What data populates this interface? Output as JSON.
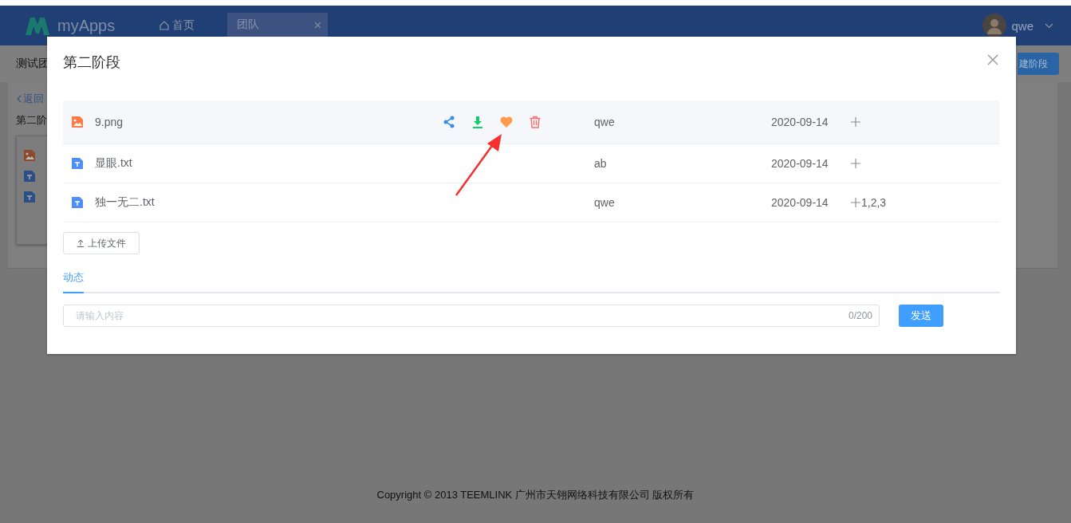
{
  "header": {
    "logo": "myApps",
    "home_link": "首页",
    "tabs": [
      {
        "label": "团队",
        "selected": true
      }
    ],
    "user": "qwe"
  },
  "subheader": {
    "title": "测试团",
    "button": "建阶段"
  },
  "background_panel": {
    "back_link": "返回",
    "stage_title": "第二阶",
    "files": [
      {
        "kind": "image"
      },
      {
        "kind": "text"
      },
      {
        "kind": "text"
      }
    ]
  },
  "dialog": {
    "title": "第二阶段",
    "files": [
      {
        "name": "9.png",
        "kind": "image",
        "hovered": true,
        "creator": "qwe",
        "date": "2020-09-14"
      },
      {
        "name": "显眼.txt",
        "kind": "text",
        "hovered": false,
        "creator": "ab",
        "date": "2020-09-14"
      },
      {
        "name": "独一无二.txt",
        "kind": "text",
        "hovered": false,
        "creator": "qwe",
        "date": "2020-09-14",
        "tags": "1,2,3"
      }
    ],
    "upload_button": "上传文件",
    "tabs": [
      {
        "label": "动态",
        "selected": true
      }
    ],
    "comment": {
      "placeholder": "请输入内容",
      "counter": "0/200",
      "send_button": "发送"
    }
  },
  "footer": "Copyright © 2013 TEEMLINK 广州市天翎网络科技有限公司 版权所有"
}
